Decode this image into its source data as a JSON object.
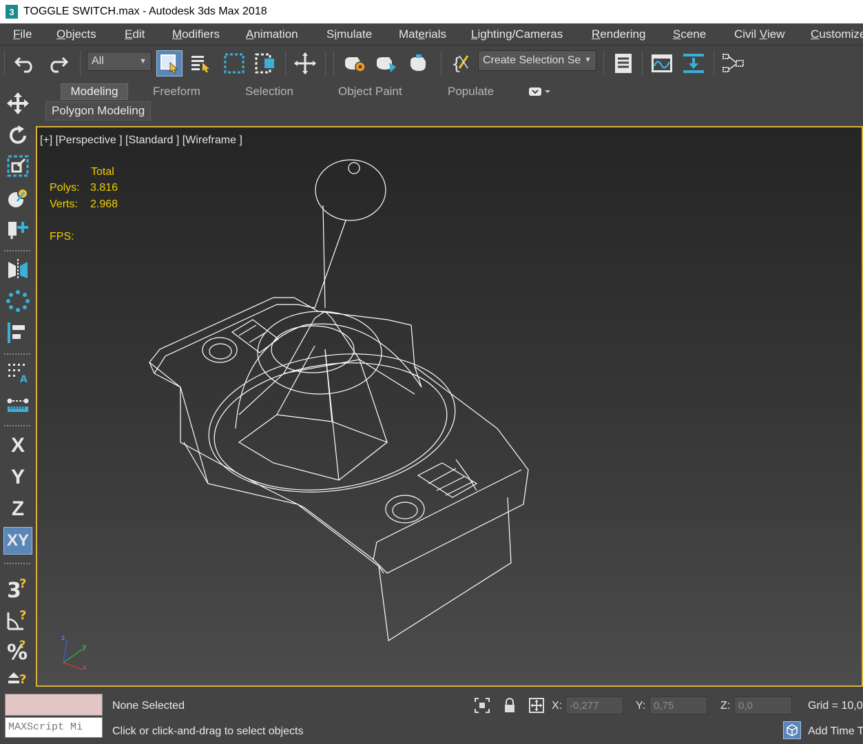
{
  "window": {
    "title": "TOGGLE SWITCH.max - Autodesk 3ds Max 2018",
    "app_icon": "3"
  },
  "menu": [
    {
      "hot": "F",
      "rest": "ile"
    },
    {
      "hot": "O",
      "rest": "bjects"
    },
    {
      "hot": "E",
      "rest": "dit"
    },
    {
      "hot": "M",
      "rest": "odifiers"
    },
    {
      "hot": "A",
      "rest": "nimation"
    },
    {
      "pre": "S",
      "hot": "i",
      "rest": "mulate"
    },
    {
      "pre": "Mat",
      "hot": "e",
      "rest": "rials"
    },
    {
      "hot": "L",
      "rest": "ighting/Cameras"
    },
    {
      "hot": "R",
      "rest": "endering"
    },
    {
      "hot": "S",
      "rest": "cene"
    },
    {
      "pre": "Civil ",
      "hot": "V",
      "rest": "iew"
    },
    {
      "hot": "C",
      "rest": "ustomize"
    }
  ],
  "toolbar": {
    "selection_filter": "All",
    "named_selection_set": "Create Selection Se",
    "icons": [
      "undo-icon",
      "redo-icon",
      "select-object-icon",
      "select-by-name-icon",
      "rectangular-region-icon",
      "window-crossing-icon",
      "select-and-move-icon",
      "render-setup-icon",
      "rendered-frame-window-icon",
      "render-production-icon",
      "edit-named-selection-icon",
      "scene-explorer-icon",
      "curve-editor-icon",
      "align-icon",
      "schematic-view-icon"
    ]
  },
  "ribbon": {
    "tabs": [
      "Modeling",
      "Freeform",
      "Selection",
      "Object Paint",
      "Populate"
    ],
    "active_tab": "Modeling",
    "panel": "Polygon Modeling"
  },
  "leftbar": {
    "axis_x": "X",
    "axis_y": "Y",
    "axis_z": "Z",
    "axis_xy": "XY"
  },
  "viewport": {
    "label": "[+] [Perspective ] [Standard ] [Wireframe ]",
    "stats": {
      "header": "Total",
      "polys_label": "Polys:",
      "polys_value": "3.816",
      "verts_label": "Verts:",
      "verts_value": "2.968",
      "fps_label": "FPS:"
    },
    "axis_tripod": {
      "x": "x",
      "y": "y",
      "z": "z"
    },
    "colors": {
      "border": "#d8b23c",
      "wire": "#ffffff",
      "stats": "#f0d000"
    }
  },
  "status": {
    "selection": "None Selected",
    "prompt": "Click or click-and-drag to select objects",
    "maxscript_placeholder": "MAXScript Mi",
    "x_label": "X:",
    "x_value": "-0,277",
    "y_label": "Y:",
    "y_value": "0,75",
    "z_label": "Z:",
    "z_value": "0,0",
    "grid": "Grid = 10,0",
    "add_time_tag": "Add Time T"
  }
}
